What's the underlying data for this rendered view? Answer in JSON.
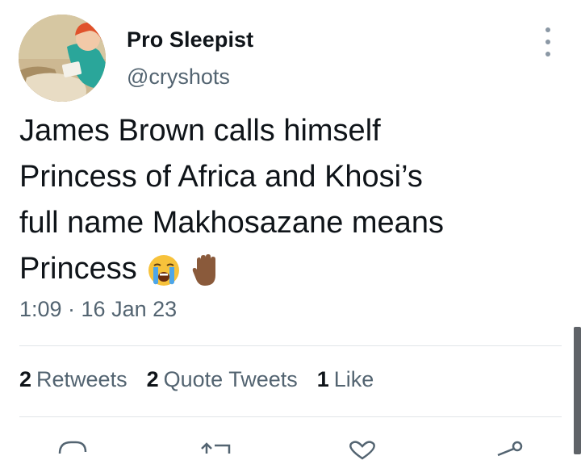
{
  "tweet": {
    "author": {
      "display_name": "Pro Sleepist",
      "handle": "@cryshots"
    },
    "text_lines": [
      "James Brown calls himself",
      "Princess of Africa and Khosi’s",
      "full name Makhosazane means",
      "Princess"
    ],
    "emojis": [
      "loudly-crying-face",
      "raised-hand-medium-dark-skin-tone"
    ],
    "timestamp": "1:09 · 16 Jan 23",
    "stats": {
      "retweets_count": "2",
      "retweets_label": "Retweets",
      "quotes_count": "2",
      "quotes_label": "Quote Tweets",
      "likes_count": "1",
      "likes_label": "Like"
    },
    "actions": [
      "reply-icon",
      "retweet-icon",
      "like-icon",
      "share-icon"
    ]
  },
  "colors": {
    "text": "#0f1419",
    "secondary": "#536471",
    "divider": "#e1e5e8"
  }
}
